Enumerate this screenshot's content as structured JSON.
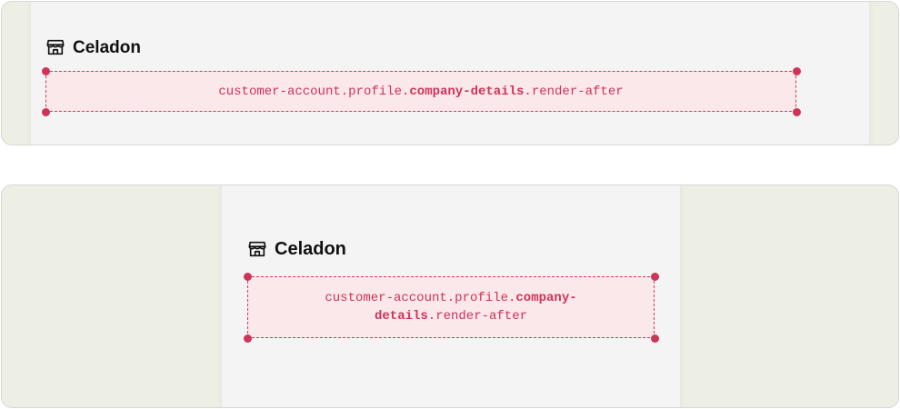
{
  "brand": {
    "name": "Celadon",
    "icon": "storefront-icon"
  },
  "extension_target": {
    "prefix": "customer-account.profile.",
    "highlight": "company-details",
    "suffix": ".render-after"
  },
  "colors": {
    "frame_background": "#edefe4",
    "page_background": "#f4f4f4",
    "slot_fill": "#fbe8ea",
    "slot_accent": "#cf3358",
    "text": "#111111"
  }
}
